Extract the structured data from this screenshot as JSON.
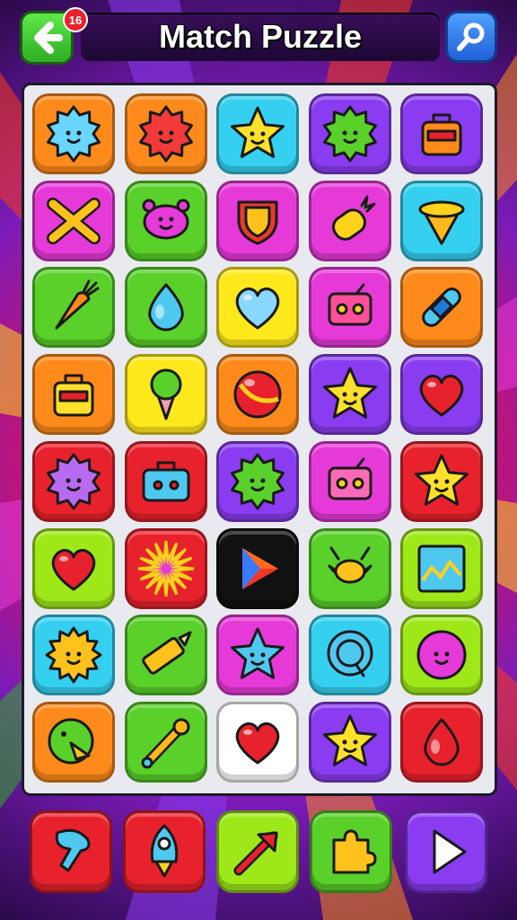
{
  "header": {
    "title": "Match Puzzle",
    "notification_count": "16",
    "back_icon": "back-arrow-icon",
    "search_icon": "search-icon"
  },
  "colors": {
    "orange": "#ff8a1c",
    "cyan": "#35d0f0",
    "purple": "#8a3cf0",
    "magenta": "#e63ad8",
    "green": "#5ad02a",
    "yellow": "#ffe81c",
    "red": "#e8222d",
    "lime": "#9ee81a",
    "black": "#111111",
    "white": "#ffffff"
  },
  "board": {
    "rows": [
      [
        {
          "bg": "orange",
          "icon": "virus-icon",
          "fill": "#6ad6ff"
        },
        {
          "bg": "orange",
          "icon": "virus-icon",
          "fill": "#f23a3a"
        },
        {
          "bg": "cyan",
          "icon": "star-icon",
          "fill": "#ffe02a"
        },
        {
          "bg": "purple",
          "icon": "virus-icon",
          "fill": "#5ad02a"
        },
        {
          "bg": "purple",
          "icon": "bag-icon",
          "fill": "#ff8a1c"
        }
      ],
      [
        {
          "bg": "magenta",
          "icon": "cross-icon",
          "fill": "#ffc21c"
        },
        {
          "bg": "green",
          "icon": "creature-icon",
          "fill": "#e63ad8"
        },
        {
          "bg": "magenta",
          "icon": "shield-icon",
          "fill": "#e83a2a"
        },
        {
          "bg": "magenta",
          "icon": "pineapple-icon",
          "fill": "#ffd21c"
        },
        {
          "bg": "cyan",
          "icon": "planet-icon",
          "fill": "#ffb81c"
        }
      ],
      [
        {
          "bg": "green",
          "icon": "carrot-icon",
          "fill": "#ff8a1c"
        },
        {
          "bg": "green",
          "icon": "drop-icon",
          "fill": "#4fc8f0"
        },
        {
          "bg": "yellow",
          "icon": "heart-icon",
          "fill": "#8ad8ff"
        },
        {
          "bg": "magenta",
          "icon": "radio-icon",
          "fill": "#ff4f9a"
        },
        {
          "bg": "orange",
          "icon": "bandage-icon",
          "fill": "#4fc8f0"
        }
      ],
      [
        {
          "bg": "orange",
          "icon": "bag-icon",
          "fill": "#ffe02a"
        },
        {
          "bg": "yellow",
          "icon": "icecream-icon",
          "fill": "#5ad02a"
        },
        {
          "bg": "orange",
          "icon": "ball-icon",
          "fill": "#e8222d"
        },
        {
          "bg": "purple",
          "icon": "star-icon",
          "fill": "#ffe02a"
        },
        {
          "bg": "purple",
          "icon": "heart-icon",
          "fill": "#e8222d"
        }
      ],
      [
        {
          "bg": "red",
          "icon": "virus-icon",
          "fill": "#b86af0"
        },
        {
          "bg": "red",
          "icon": "toolbox-icon",
          "fill": "#4fc8f0"
        },
        {
          "bg": "purple",
          "icon": "virus-icon",
          "fill": "#5ad02a"
        },
        {
          "bg": "magenta",
          "icon": "radio-icon",
          "fill": "#ff6ab8"
        },
        {
          "bg": "red",
          "icon": "star-icon",
          "fill": "#ffe02a"
        }
      ],
      [
        {
          "bg": "lime",
          "icon": "heart-icon",
          "fill": "#e8222d"
        },
        {
          "bg": "red",
          "icon": "burst-icon",
          "fill": "#e63ad8"
        },
        {
          "bg": "black",
          "icon": "play-logo-icon",
          "fill": "#ff6a1c"
        },
        {
          "bg": "green",
          "icon": "bull-icon",
          "fill": "#ffc21c"
        },
        {
          "bg": "lime",
          "icon": "chart-icon",
          "fill": "#4fc8f0"
        }
      ],
      [
        {
          "bg": "cyan",
          "icon": "sun-icon",
          "fill": "#ffc21c"
        },
        {
          "bg": "green",
          "icon": "pencil-icon",
          "fill": "#ffc21c"
        },
        {
          "bg": "magenta",
          "icon": "star-icon",
          "fill": "#4fc8f0"
        },
        {
          "bg": "cyan",
          "icon": "chat-icon",
          "fill": "#4fc8f0"
        },
        {
          "bg": "lime",
          "icon": "blob-icon",
          "fill": "#e63ad8"
        }
      ],
      [
        {
          "bg": "orange",
          "icon": "bird-icon",
          "fill": "#5ad02a"
        },
        {
          "bg": "green",
          "icon": "wand-icon",
          "fill": "#ffb81c"
        },
        {
          "bg": "white",
          "icon": "heart-icon",
          "fill": "#e8222d"
        },
        {
          "bg": "purple",
          "icon": "star-icon",
          "fill": "#ffe02a"
        },
        {
          "bg": "red",
          "icon": "drop-icon",
          "fill": "#e8222d"
        }
      ]
    ]
  },
  "powerups": [
    {
      "bg": "#e8222d",
      "icon": "tool-icon",
      "fill": "#4fc8f0"
    },
    {
      "bg": "#e8222d",
      "icon": "rocket-icon",
      "fill": "#4fc8f0"
    },
    {
      "bg": "#9ee81a",
      "icon": "arrow-icon",
      "fill": "#e8222d"
    },
    {
      "bg": "#5ad02a",
      "icon": "puzzle-icon",
      "fill": "#ffc21c"
    },
    {
      "bg": "#8a3cf0",
      "icon": "play-icon",
      "fill": "#ffffff"
    }
  ]
}
